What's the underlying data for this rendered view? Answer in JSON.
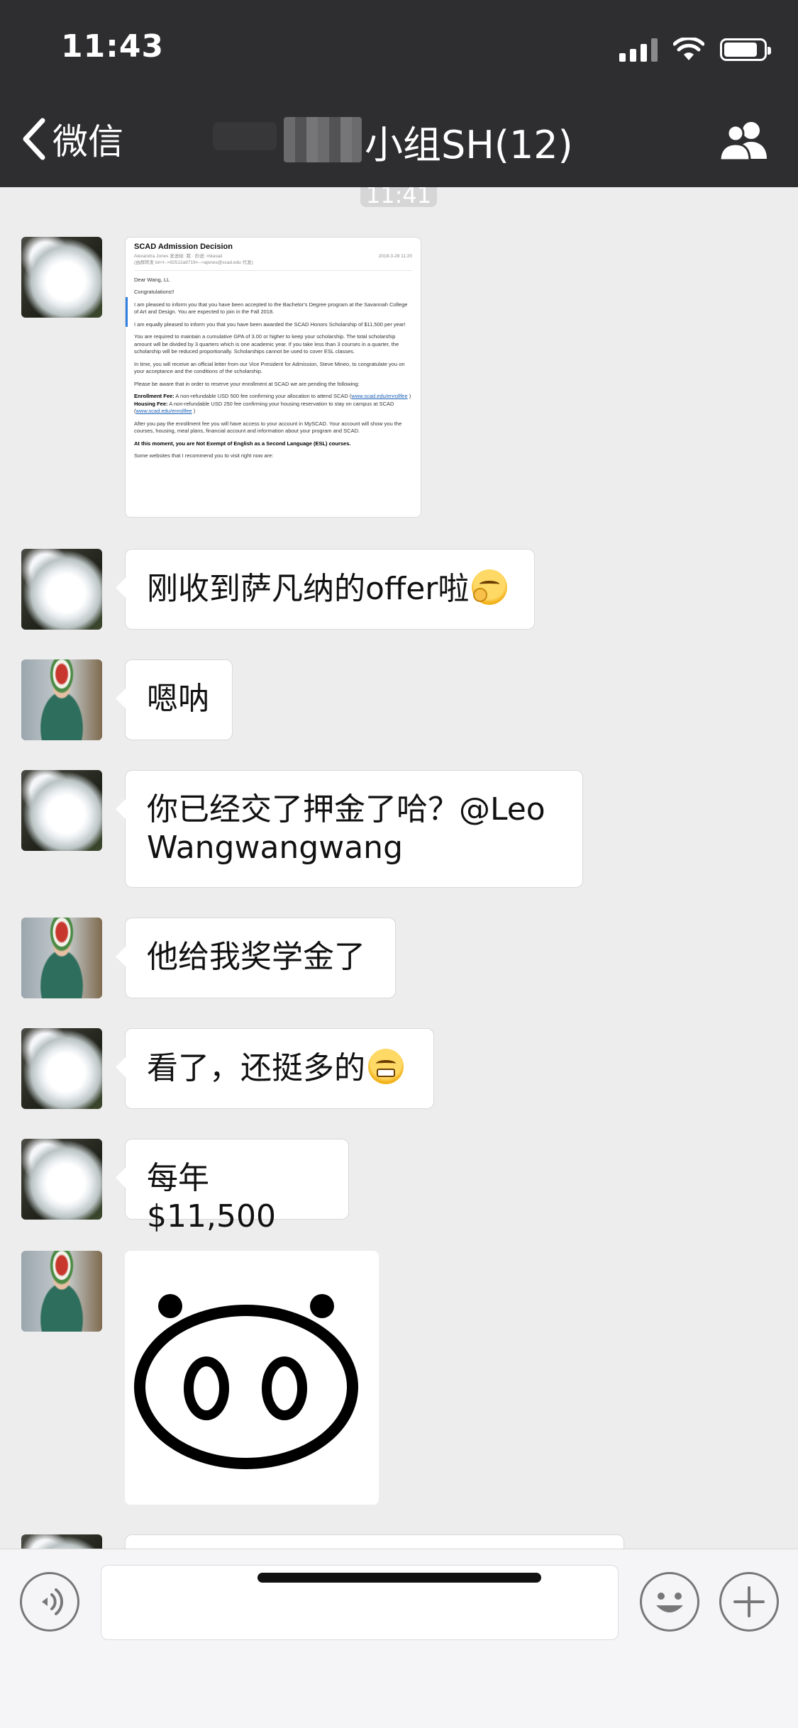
{
  "status_bar": {
    "time": "11:43"
  },
  "header": {
    "back_label": "微信",
    "title": "小组SH(12)"
  },
  "time_separator": "11:41",
  "email_card": {
    "subject": "SCAD Admission Decision",
    "sender": "Alexandra Jones",
    "meta_extra": "发送给: 我 · 抄送: mkasaii",
    "sender_addr": "(由群转发 bri+l-->92512a9719<-->ajones@scad.edu 代发)",
    "date": "2018-3-28 11:20",
    "greeting": "Dear Wang, LL",
    "congrats": "Congratulations!!",
    "p1": "I am pleased to inform you that you have been accepted to the Bachelor's Degree program at the Savannah College of Art and Design. You are expected to join in the Fall 2018.",
    "p2": "I am equally pleased to inform you that you have been awarded the SCAD Honors Scholarship of $11,500 per year!",
    "p3": "You are required to maintain a cumulative GPA of 3.00 or higher to keep your scholarship. The total scholarship amount will be divided by 3 quarters which is one academic year. If you take less than 3 courses in a quarter, the scholarship will be reduced proportionally. Scholarships cannot be used to cover ESL classes.",
    "p4": "In time, you will receive an official letter from our Vice President for Admission, Steve Mineo, to congratulate you on your acceptance and the conditions of the scholarship.",
    "p5": "Please be aware that in order to reserve your enrollment at SCAD we are pending the following:",
    "fee1_label": "Enrollment Fee:",
    "fee1_text": "A non-refundable USD 500 fee confirming your allocation to attend SCAD (",
    "fee1_link": "www.scad.edu/enrollfee",
    "fee2_label": "Housing Fee:",
    "fee2_text": "A non-refundable USD 250 fee confirming your housing reservation to stay on campus at SCAD (",
    "fee2_link": "www.scad.edu/enrollfee",
    "p6": "After you pay the enrollment fee you will have access to your account in MySCAD. Your account will show you the courses, housing, meal plans, financial account and information about your program and SCAD.",
    "p7": "At this moment, you are Not Exempt of English as a Second Language (ESL) courses.",
    "p8": "Some websites that I recommend you to visit right now are:"
  },
  "messages": [
    {
      "text": "刚收到萨凡纳的offer啦",
      "emoji": "hand-over-mouth-emoji"
    },
    {
      "text": "嗯呐"
    },
    {
      "text": "你已经交了押金了哈？@Leo Wangwangwang",
      "line1": "你已经交了押金了哈？@Leo",
      "line2": "Wangwangwang"
    },
    {
      "text": "他给我奖学金了"
    },
    {
      "text": "看了，还挺多的",
      "emoji": "grimacing-emoji"
    },
    {
      "text": "每年$11,500"
    }
  ],
  "sticker": "pig-nose-sticker",
  "colors": {
    "header_bg": "#2e2e30",
    "chat_bg": "#ededed",
    "bubble_bg": "#ffffff",
    "input_bg": "#f5f5f7"
  }
}
